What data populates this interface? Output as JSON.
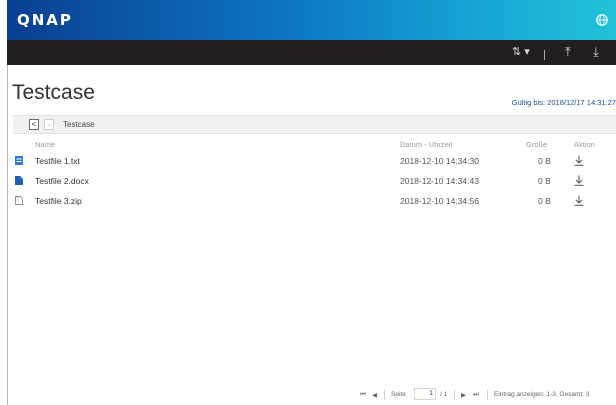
{
  "app": {
    "logo": "QNAP"
  },
  "toolbar": {
    "sort_label": "⇅ ▾",
    "upload_label": "⤒",
    "download_label": "⤓"
  },
  "folder": {
    "title": "Testcase",
    "valid_until": "Gültig bis: 2018/12/17 14:31:27"
  },
  "breadcrumb": {
    "back": "<",
    "forward": "›",
    "path": "Testcase"
  },
  "columns": {
    "name": "Name",
    "date": "Datum - Uhrzeit",
    "size": "Größe",
    "action": "Aktion"
  },
  "files": [
    {
      "name": "Testfile 1.txt",
      "date": "2018-12-10 14:34:30",
      "size": "0 B",
      "icon": "txt-file-icon"
    },
    {
      "name": "Testfile 2.docx",
      "date": "2018-12-10 14:34:43",
      "size": "0 B",
      "icon": "docx-file-icon"
    },
    {
      "name": "Testfile 3.zip",
      "date": "2018-12-10 14:34:56",
      "size": "0 B",
      "icon": "zip-file-icon"
    }
  ],
  "pager": {
    "first": "⏮",
    "prev": "◀",
    "page_label": "Seite",
    "page_value": "1",
    "total_pages": "/ 1",
    "next": "▶",
    "last": "⏭",
    "summary": "Eintrag anzeigen: 1-3, Gesamt: 3"
  },
  "colors": {
    "accent": "#1a4f9c",
    "toolbar": "#231f20",
    "header_start": "#0b3f8f",
    "header_end": "#22c1d7"
  }
}
